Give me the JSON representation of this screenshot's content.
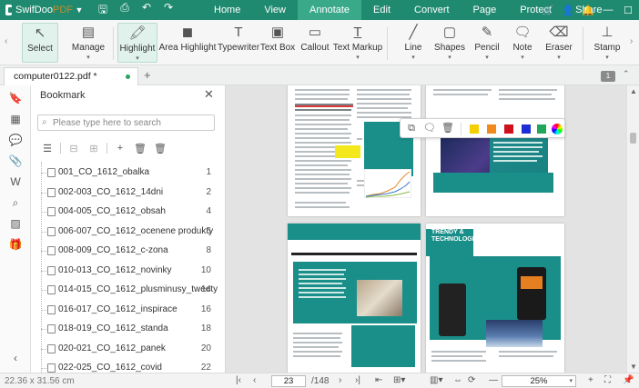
{
  "app": {
    "name": "SwifDoo",
    "name_faded": "PDF"
  },
  "menu": [
    "Home",
    "View",
    "Annotate",
    "Edit",
    "Convert",
    "Page",
    "Protect",
    "Share"
  ],
  "menu_active": "Annotate",
  "ribbon": {
    "select": "Select",
    "manage": "Manage",
    "highlight": "Highlight",
    "area_highlight": "Area Highlight",
    "typewriter": "Typewriter",
    "text_box": "Text Box",
    "callout": "Callout",
    "text_markup": "Text Markup",
    "line": "Line",
    "shapes": "Shapes",
    "pencil": "Pencil",
    "note": "Note",
    "eraser": "Eraser",
    "stamp": "Stamp"
  },
  "tab": {
    "filename": "computer0122.pdf *",
    "page_badge": "1"
  },
  "bookmark": {
    "title": "Bookmark",
    "search_placeholder": "Please type here to search",
    "items": [
      {
        "title": "001_CO_1612_obalka",
        "page": "1"
      },
      {
        "title": "002-003_CO_1612_14dni",
        "page": "2"
      },
      {
        "title": "004-005_CO_1612_obsah",
        "page": "4"
      },
      {
        "title": "006-007_CO_1612_ocenene produkty",
        "page": "6"
      },
      {
        "title": "008-009_CO_1612_c-zona",
        "page": "8"
      },
      {
        "title": "010-013_CO_1612_novinky",
        "page": "10"
      },
      {
        "title": "014-015_CO_1612_plusminusy_tweety",
        "page": "14"
      },
      {
        "title": "016-017_CO_1612_inspirace",
        "page": "16"
      },
      {
        "title": "018-019_CO_1612_standa",
        "page": "18"
      },
      {
        "title": "020-021_CO_1612_panek",
        "page": "20"
      },
      {
        "title": "022-025_CO_1612_covid",
        "page": "22"
      }
    ]
  },
  "page_text": {
    "trendy": "TRENDY &",
    "technologie": "TECHNOLOGIE"
  },
  "float_colors": [
    "#f5d000",
    "#f08a1c",
    "#d0101c",
    "#1c2fd6",
    "#22a65a"
  ],
  "status": {
    "dims": "22.36 x 31.56 cm",
    "current_page": "23",
    "total_pages": "/148",
    "zoom": "25%"
  }
}
